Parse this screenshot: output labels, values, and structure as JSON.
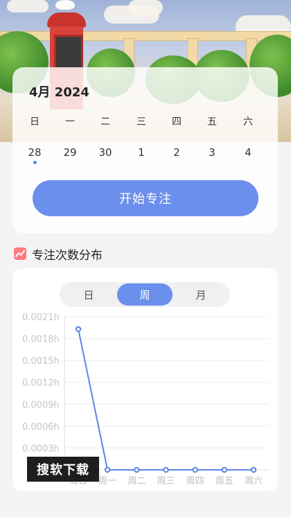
{
  "calendar": {
    "month_label": "4月  2024",
    "weekdays": [
      "日",
      "一",
      "二",
      "三",
      "四",
      "五",
      "六"
    ],
    "days": [
      "28",
      "29",
      "30",
      "1",
      "2",
      "3",
      "4"
    ],
    "selected_day": "28"
  },
  "start_button": "开始专注",
  "section": {
    "title": "专注次数分布",
    "icon": "trend-chart-icon"
  },
  "range_tabs": [
    "日",
    "周",
    "月"
  ],
  "active_tab": "周",
  "chart_data": {
    "type": "line",
    "x": [
      "周日",
      "周一",
      "周二",
      "周三",
      "周四",
      "周五",
      "周六"
    ],
    "series": [
      {
        "values": [
          0.00193,
          0,
          0,
          0,
          0,
          0,
          0
        ]
      }
    ],
    "y_ticks": [
      "0.0021h",
      "0.0018h",
      "0.0015h",
      "0.0012h",
      "0.0009h",
      "0.0006h",
      "0.0003h"
    ],
    "ylim": [
      0,
      0.0021
    ],
    "grid": true,
    "color": "#5b84e6"
  },
  "watermark": "搜软下载",
  "colors": {
    "accent": "#6b8fec",
    "line": "#5b84e6"
  }
}
